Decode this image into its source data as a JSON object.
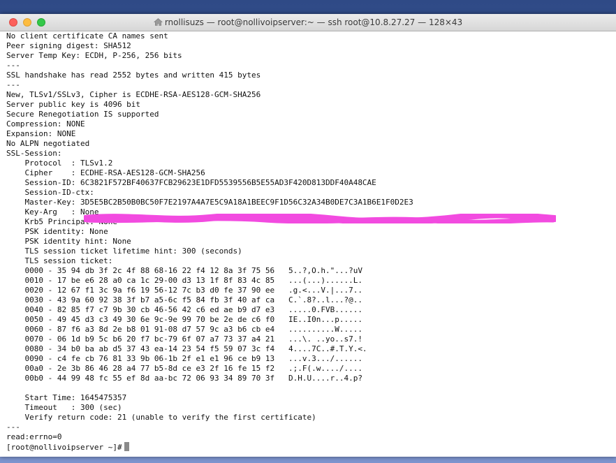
{
  "window": {
    "title": "rnollisuzs — root@nollivoipserver:~ — ssh root@10.8.27.27 — 128×43",
    "icon": "home-icon",
    "controls": [
      "close",
      "minimize",
      "zoom"
    ]
  },
  "terminal": {
    "lines": [
      "No client certificate CA names sent",
      "Peer signing digest: SHA512",
      "Server Temp Key: ECDH, P-256, 256 bits",
      "---",
      "SSL handshake has read 2552 bytes and written 415 bytes",
      "---",
      "New, TLSv1/SSLv3, Cipher is ECDHE-RSA-AES128-GCM-SHA256",
      "Server public key is 4096 bit",
      "Secure Renegotiation IS supported",
      "Compression: NONE",
      "Expansion: NONE",
      "No ALPN negotiated",
      "SSL-Session:",
      "    Protocol  : TLSv1.2",
      "    Cipher    : ECDHE-RSA-AES128-GCM-SHA256",
      "    Session-ID: 6C3821F572BF40637FCB29623E1DFD5539556B5E55AD3F420D813DDF40A48CAE",
      "    Session-ID-ctx:",
      "    Master-Key: 3D5E5BC2B50B0BC50F7E2197A4A7E5C9A18A1BEEC9F1D56C32A34B0DE7C3A1B6E1F0D2E3",
      "    Key-Arg   : None",
      "    Krb5 Principal: None",
      "    PSK identity: None",
      "    PSK identity hint: None",
      "    TLS session ticket lifetime hint: 300 (seconds)",
      "    TLS session ticket:",
      "    0000 - 35 94 db 3f 2c 4f 88 68-16 22 f4 12 8a 3f 75 56   5..?,O.h.\"...?uV",
      "    0010 - 17 be e6 28 a0 ca 1c 29-00 d3 13 1f 8f 83 4c 85   ...(...)......L.",
      "    0020 - 12 67 f1 3c 9a f6 19 56-12 7c b3 d0 fe 37 90 ee   .g.<...V.|...7..",
      "    0030 - 43 9a 60 92 38 3f b7 a5-6c f5 84 fb 3f 40 af ca   C.`.8?..l...?@..",
      "    0040 - 82 85 f7 c7 9b 30 cb 46-56 42 c6 ed ae b9 d7 e3   .....0.FVB......",
      "    0050 - 49 45 d3 c3 49 30 6e 9c-9e 99 70 be 2e de c6 f0   IE..I0n...p.....",
      "    0060 - 87 f6 a3 8d 2e b8 01 91-08 d7 57 9c a3 b6 cb e4   ..........W.....",
      "    0070 - 06 1d b9 5c b6 20 f7 bc-79 6f 07 a7 73 37 a4 21   ...\\. ..yo..s7.!",
      "    0080 - 34 b0 ba ab d5 37 43 ea-14 23 54 f5 59 07 3c f4   4....7C..#.T.Y.<.",
      "    0090 - c4 fe cb 76 81 33 9b 06-1b 2f e1 e1 96 ce b9 13   ...v.3.../......",
      "    00a0 - 2e 3b 86 46 28 a4 77 b5-8d ce e3 2f 16 fe 15 f2   .;.F(.w..../....",
      "    00b0 - 44 99 48 fc 55 ef 8d aa-bc 72 06 93 34 89 70 3f   D.H.U....r..4.p?",
      "",
      "    Start Time: 1645475357",
      "    Timeout   : 300 (sec)",
      "    Verify return code: 21 (unable to verify the first certificate)",
      "---",
      "read:errno=0"
    ],
    "prompt": "[root@nollivoipserver ~]# ",
    "redaction_color": "#f24be0"
  }
}
